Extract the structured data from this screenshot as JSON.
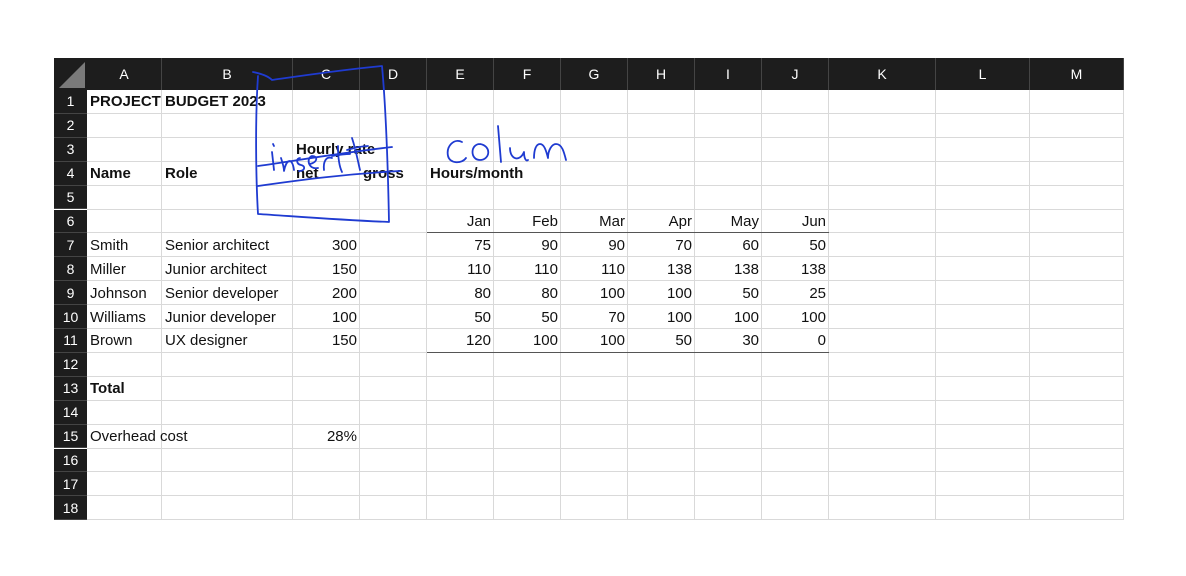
{
  "columns": [
    "A",
    "B",
    "C",
    "D",
    "E",
    "F",
    "G",
    "H",
    "I",
    "J",
    "K",
    "L",
    "M"
  ],
  "rows": [
    "1",
    "2",
    "3",
    "4",
    "5",
    "6",
    "7",
    "8",
    "9",
    "10",
    "11",
    "12",
    "13",
    "14",
    "15",
    "16",
    "17",
    "18"
  ],
  "cells": {
    "title": "PROJECT BUDGET 2023",
    "hourly_rate": "Hourly rate",
    "name_hdr": "Name",
    "role_hdr": "Role",
    "net_hdr": "net",
    "gross_hdr": "gross",
    "hours_hdr": "Hours/month",
    "months": [
      "Jan",
      "Feb",
      "Mar",
      "Apr",
      "May",
      "Jun"
    ],
    "people": [
      {
        "name": "Smith",
        "role": "Senior architect",
        "rate": "300",
        "hours": [
          "75",
          "90",
          "90",
          "70",
          "60",
          "50"
        ]
      },
      {
        "name": "Miller",
        "role": "Junior architect",
        "rate": "150",
        "hours": [
          "110",
          "110",
          "110",
          "138",
          "138",
          "138"
        ]
      },
      {
        "name": "Johnson",
        "role": "Senior developer",
        "rate": "200",
        "hours": [
          "80",
          "80",
          "100",
          "100",
          "50",
          "25"
        ]
      },
      {
        "name": "Williams",
        "role": "Junior developer",
        "rate": "100",
        "hours": [
          "50",
          "50",
          "70",
          "100",
          "100",
          "100"
        ]
      },
      {
        "name": "Brown",
        "role": "UX designer",
        "rate": "150",
        "hours": [
          "120",
          "100",
          "100",
          "50",
          "30",
          "0"
        ]
      }
    ],
    "total": "Total",
    "overhead_label": "Overhead cost",
    "overhead_value": "28%"
  },
  "annotation": {
    "handwriting": "insert colum",
    "ink_color": "#1f3bd1"
  },
  "colors": {
    "header_bg": "#1d1d1d",
    "header_text": "#ffffff",
    "gridline": "#d9d9d9"
  }
}
